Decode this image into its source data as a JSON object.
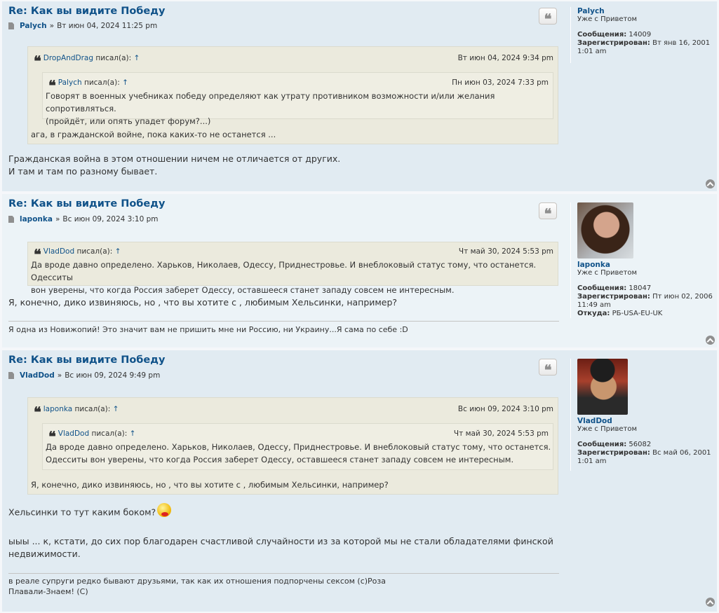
{
  "posts": [
    {
      "title": "Re: Как вы видите Победу",
      "author": "Palych",
      "date": "Вт июн 04, 2024 11:25 pm",
      "quote": {
        "user": "DropAndDrag",
        "wrote": "писал(а):",
        "arrow": "↑",
        "date": "Вт июн 04, 2024 9:34 pm",
        "nested": {
          "user": "Palych",
          "wrote": "писал(а):",
          "arrow": "↑",
          "date": "Пн июн 03, 2024 7:33 pm",
          "line1": "Говорят в военных учебниках победу определяют как утрату противником возможности и/или желания сопротивляться.",
          "line2": "(пройдёт, или опять упадет форум?...)"
        },
        "text": "ага, в гражданской войне, пока каких-то не останется ..."
      },
      "body_line1": "Гражданская война в этом отношении ничем не отличается от других.",
      "body_line2": "И там и там по разному бывает.",
      "profile": {
        "name": "Palych",
        "rank": "Уже с Приветом",
        "posts_label": "Сообщения:",
        "posts": "14009",
        "joined_label": "Зарегистрирован:",
        "joined_a": "Вт янв 16, 2001",
        "joined_b": "1:01 am"
      }
    },
    {
      "title": "Re: Как вы видите Победу",
      "author": "laponka",
      "date": "Вс июн 09, 2024 3:10 pm",
      "quote": {
        "user": "VladDod",
        "wrote": "писал(а):",
        "arrow": "↑",
        "date": "Чт май 30, 2024 5:53 pm",
        "line1": "Да вроде давно определено. Харьков, Николаев, Одессу, Приднестровье. И внеблоковый статус тому, что останется. Одесситы",
        "line2": "вон уверены, что когда Россия заберет Одессу, оставшееся станет западу совсем не интересным."
      },
      "body_line1": "Я, конечно, дико извиняюсь, но , что вы хотите с , любимым Хельсинки, например?",
      "signature": "Я одна из Новижопий! Это значит вам не пришить мне ни Россию, ни Украину...Я сама по себе :D",
      "profile": {
        "name": "laponka",
        "rank": "Уже с Приветом",
        "posts_label": "Сообщения:",
        "posts": "18047",
        "joined_label": "Зарегистрирован:",
        "joined_a": "Пт июн 02, 2006",
        "joined_b": "11:49 am",
        "location_label": "Откуда:",
        "location": "PБ-USA-EU-UK"
      }
    },
    {
      "title": "Re: Как вы видите Победу",
      "author": "VladDod",
      "date": "Вс июн 09, 2024 9:49 pm",
      "quote": {
        "user": "laponka",
        "wrote": "писал(а):",
        "arrow": "↑",
        "date": "Вс июн 09, 2024 3:10 pm",
        "nested": {
          "user": "VladDod",
          "wrote": "писал(а):",
          "arrow": "↑",
          "date": "Чт май 30, 2024 5:53 pm",
          "line1": "Да вроде давно определено. Харьков, Николаев, Одессу, Приднестровье. И внеблоковый статус тому, что останется.",
          "line2": "Одесситы вон уверены, что когда Россия заберет Одессу, оставшееся станет западу совсем не интересным."
        },
        "text": "Я, конечно, дико извиняюсь, но , что вы хотите с , любимым Хельсинки, например?"
      },
      "body_line1": "Хельсинки то тут каким боком?",
      "body_line2": "ыыы ... к, кстати, до сих пор благодарен счастливой случайности из за которой мы не стали обладателями финской",
      "body_line3": "недвижимости.",
      "signature_line1": "в реале супруги редко бывают друзьями, так как их отношения подпорчены сексом (с)Роза",
      "signature_line2": "Плавали-Знаем! (С)",
      "profile": {
        "name": "VladDod",
        "rank": "Уже с Приветом",
        "posts_label": "Сообщения:",
        "posts": "56082",
        "joined_label": "Зарегистрирован:",
        "joined_a": "Вс май 06, 2001",
        "joined_b": "1:01 am"
      }
    }
  ],
  "icons": {
    "quote_button": "quote-icon",
    "back_to_top": "chevron-up-icon",
    "post_icon": "document-icon",
    "smiley": "smiley-icon"
  },
  "colors": {
    "link": "#105289",
    "post_bg_alt": "#e1ebf2",
    "post_bg": "#ecf3f7",
    "quote_bg": "#ebeadd"
  }
}
